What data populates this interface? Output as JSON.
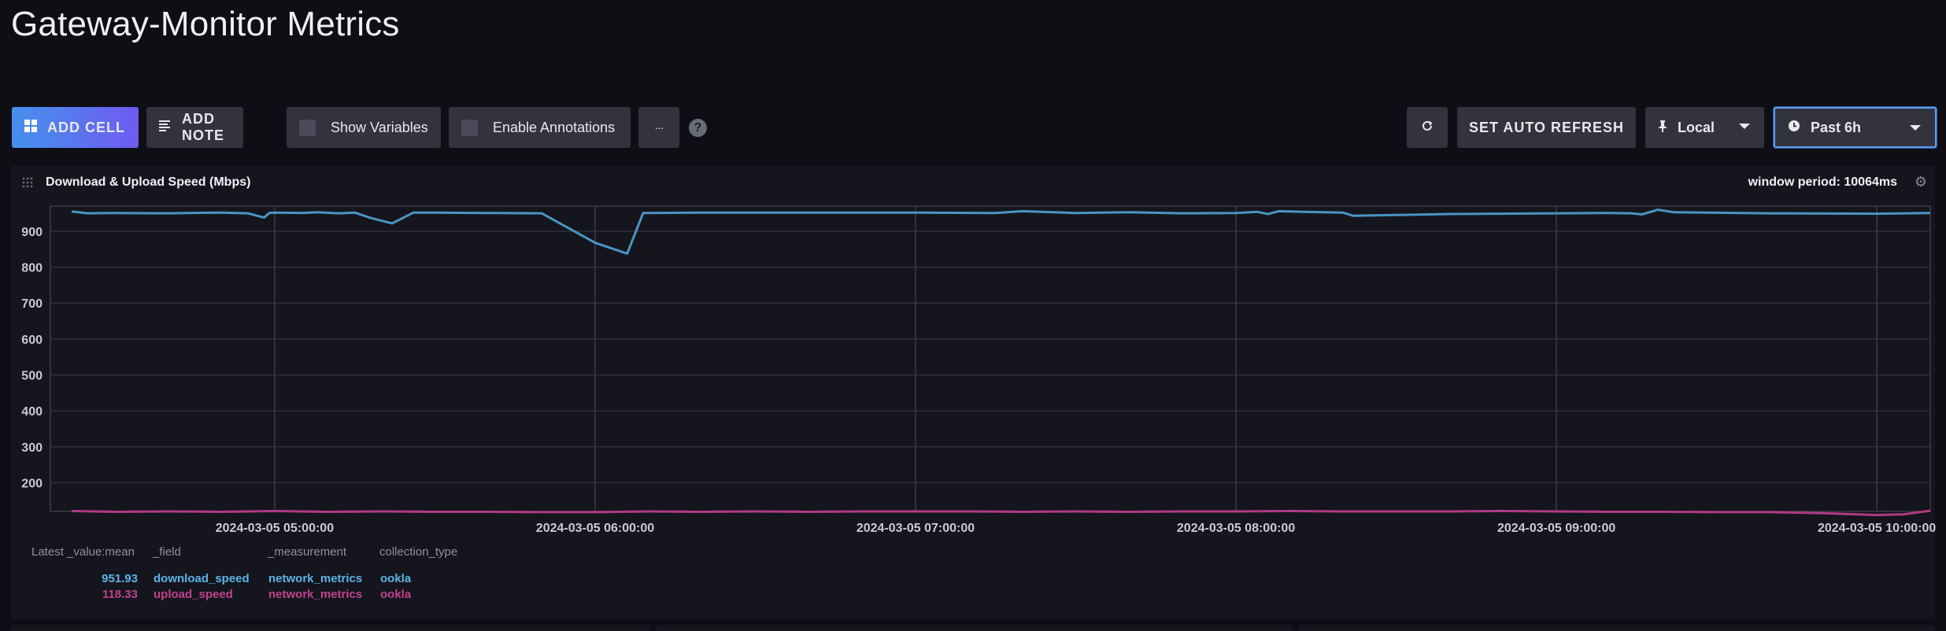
{
  "dashboard": {
    "title": "Gateway-Monitor Metrics"
  },
  "toolbar": {
    "add_cell": "ADD CELL",
    "add_note": "ADD NOTE",
    "show_variables": "Show Variables",
    "enable_annotations": "Enable Annotations",
    "more": "···",
    "help": "?",
    "auto_refresh": "SET AUTO REFRESH",
    "timezone": "Local",
    "time_range": "Past 6h"
  },
  "cell": {
    "title": "Download & Upload Speed (Mbps)",
    "window_period": "window period: 10064ms"
  },
  "legend": {
    "headers": [
      "Latest _value:mean",
      "_field",
      "_measurement",
      "collection_type"
    ],
    "rows": [
      {
        "value": "951.93",
        "field": "download_speed",
        "measurement": "network_metrics",
        "collection_type": "ookla",
        "color": "#5ab4e8"
      },
      {
        "value": "118.33",
        "field": "upload_speed",
        "measurement": "network_metrics",
        "collection_type": "ookla",
        "color": "#c0418e"
      }
    ]
  },
  "colors": {
    "accent": "#4591ed",
    "download": "#4a94c4",
    "upload": "#b03a86"
  },
  "chart_data": {
    "type": "line",
    "ylim": [
      120,
      970
    ],
    "y_ticks": [
      200,
      300,
      400,
      500,
      600,
      700,
      800,
      900
    ],
    "x_range": [
      "2024-03-05 04:18",
      "2024-03-05 10:10"
    ],
    "x_ticks": [
      "2024-03-05 05:00:00",
      "2024-03-05 06:00:00",
      "2024-03-05 07:00:00",
      "2024-03-05 08:00:00",
      "2024-03-05 09:00:00",
      "2024-03-05 10:00:00"
    ],
    "grid": true,
    "series": [
      {
        "name": "download_speed",
        "x": [
          "04:22",
          "04:25",
          "04:30",
          "04:40",
          "04:50",
          "04:55",
          "04:58",
          "04:59",
          "05:00",
          "05:05",
          "05:08",
          "05:12",
          "05:15",
          "05:18",
          "05:22",
          "05:26",
          "05:30",
          "05:40",
          "05:50",
          "06:00",
          "06:06",
          "06:09",
          "06:20",
          "06:40",
          "07:00",
          "07:15",
          "07:20",
          "07:30",
          "07:40",
          "07:50",
          "08:00",
          "08:04",
          "08:06",
          "08:08",
          "08:10",
          "08:20",
          "08:22",
          "08:40",
          "09:00",
          "09:10",
          "09:14",
          "09:16",
          "09:19",
          "09:22",
          "09:40",
          "10:00",
          "10:10"
        ],
        "values": [
          955,
          950,
          951,
          950,
          952,
          950,
          938,
          951,
          952,
          951,
          953,
          950,
          952,
          937,
          922,
          952,
          952,
          951,
          950,
          868,
          838,
          951,
          952,
          952,
          952,
          951,
          956,
          951,
          953,
          950,
          951,
          954,
          948,
          956,
          955,
          952,
          943,
          948,
          950,
          951,
          950,
          947,
          960,
          953,
          950,
          949,
          951
        ]
      },
      {
        "name": "upload_speed",
        "x": [
          "04:22",
          "04:30",
          "04:40",
          "04:50",
          "05:00",
          "05:10",
          "05:20",
          "05:30",
          "05:40",
          "05:50",
          "06:00",
          "06:10",
          "06:20",
          "06:30",
          "06:40",
          "06:50",
          "07:00",
          "07:10",
          "07:20",
          "07:30",
          "07:40",
          "07:50",
          "08:00",
          "08:10",
          "08:20",
          "08:30",
          "08:40",
          "08:50",
          "09:00",
          "09:10",
          "09:20",
          "09:30",
          "09:40",
          "09:50",
          "10:00",
          "10:05",
          "10:10"
        ],
        "values": [
          121,
          119,
          120,
          119,
          121,
          119,
          120,
          119,
          119,
          118,
          118,
          120,
          119,
          120,
          119,
          120,
          120,
          120,
          119,
          120,
          119,
          120,
          120,
          121,
          120,
          120,
          120,
          121,
          120,
          119,
          119,
          118,
          118,
          115,
          110,
          112,
          122
        ]
      }
    ]
  }
}
